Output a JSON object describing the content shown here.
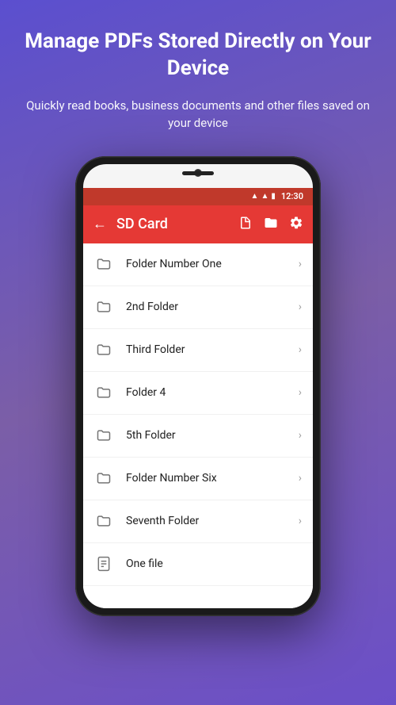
{
  "hero": {
    "title": "Manage PDFs Stored Directly on Your Device",
    "subtitle": "Quickly read books, business documents and other files saved on your device"
  },
  "status_bar": {
    "time": "12:30"
  },
  "app_bar": {
    "title": "SD Card",
    "back_icon": "←",
    "icons": [
      "doc-icon",
      "folder-icon",
      "settings-icon"
    ]
  },
  "file_list": {
    "items": [
      {
        "name": "Folder Number One",
        "type": "folder"
      },
      {
        "name": "2nd Folder",
        "type": "folder"
      },
      {
        "name": "Third Folder",
        "type": "folder"
      },
      {
        "name": "Folder 4",
        "type": "folder"
      },
      {
        "name": "5th Folder",
        "type": "folder"
      },
      {
        "name": "Folder Number Six",
        "type": "folder"
      },
      {
        "name": "Seventh Folder",
        "type": "folder"
      },
      {
        "name": "One file",
        "type": "file"
      }
    ]
  }
}
